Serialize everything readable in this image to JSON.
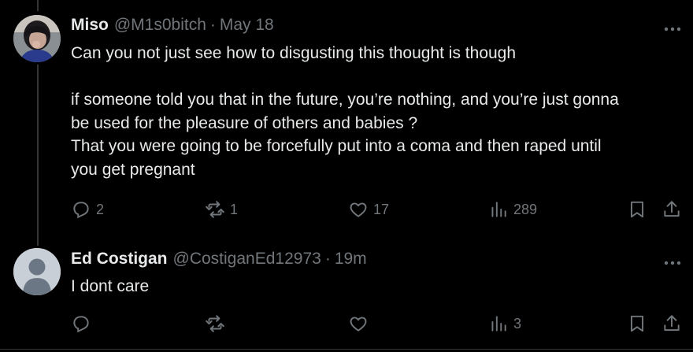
{
  "thread": [
    {
      "display_name": "Miso",
      "handle": "@M1s0bitch",
      "separator": "·",
      "time": "May 18",
      "avatar_icon": "user-photo-avatar",
      "text_lines": [
        "Can you not just see how to disgusting this thought is though",
        "",
        "if someone told you that in the future, you’re nothing, and you’re just gonna",
        "be used for the pleasure of others and babies ?",
        "That you were going to be forcefully put into a coma and then raped until",
        "you get pregnant"
      ],
      "counts": {
        "replies": "2",
        "reposts": "1",
        "likes": "17",
        "views": "289"
      }
    },
    {
      "display_name": "Ed Costigan",
      "handle": "@CostiganEd12973",
      "separator": "·",
      "time": "19m",
      "avatar_icon": "default-avatar",
      "text_lines": [
        "I dont care"
      ],
      "counts": {
        "replies": "",
        "reposts": "",
        "likes": "",
        "views": "3"
      }
    }
  ],
  "colors": {
    "background": "#000000",
    "text": "#e7e9ea",
    "muted": "#71767b",
    "line": "#333639"
  }
}
